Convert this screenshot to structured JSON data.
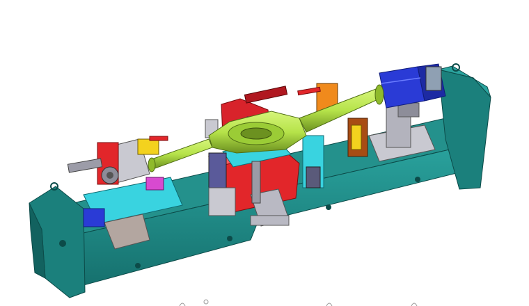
{
  "scene": {
    "subject": "cad-fixture-render",
    "palette": {
      "base_teal": "#1f8a86",
      "base_dark": "#0f5654",
      "axle_green": "#b6e34a",
      "axle_dark": "#6c9120",
      "red_block": "#e2262a",
      "blue_motor": "#2a3bd6",
      "cyan_plate": "#39d3e0",
      "grey_metal": "#a9a9b3",
      "purple_part": "#7a3fb8",
      "yellow_part": "#f3d21e",
      "orange_part": "#f08a1c",
      "magenta_part": "#d84ad0"
    }
  }
}
